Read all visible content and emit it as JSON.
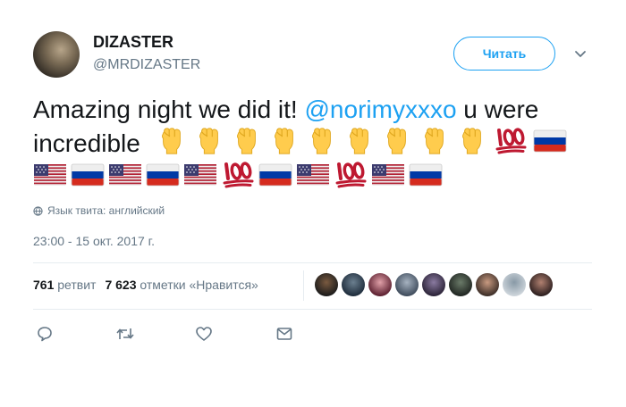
{
  "user": {
    "name": "DIZASTER",
    "handle": "@MRDIZASTER",
    "follow_label": "Читать"
  },
  "tweet": {
    "text_part1": "Amazing night we did it! ",
    "mention": "@norimyxxxo",
    "text_part2": " u were incredible"
  },
  "emoji_sequence": [
    "fist",
    "fist",
    "fist",
    "fist",
    "fist",
    "fist",
    "fist",
    "fist",
    "fist",
    "hundred",
    "flag-ru",
    "flag-us",
    "flag-ru",
    "flag-us",
    "flag-ru",
    "flag-us",
    "hundred",
    "flag-ru",
    "flag-us",
    "hundred",
    "flag-us",
    "flag-ru"
  ],
  "language_note": "Язык твита: английский",
  "timestamp": "23:00 - 15 окт. 2017 г.",
  "stats": {
    "retweets_count": "761",
    "retweets_label": "ретвит",
    "likes_count": "7 623",
    "likes_label": "отметки «Нравится»"
  },
  "likers_count": 9,
  "actions": [
    "reply-icon",
    "retweet-icon",
    "like-icon",
    "message-icon"
  ],
  "colors": {
    "accent": "#1da1f2",
    "text": "#14171a",
    "muted": "#657786",
    "divider": "#e6ecf0"
  }
}
